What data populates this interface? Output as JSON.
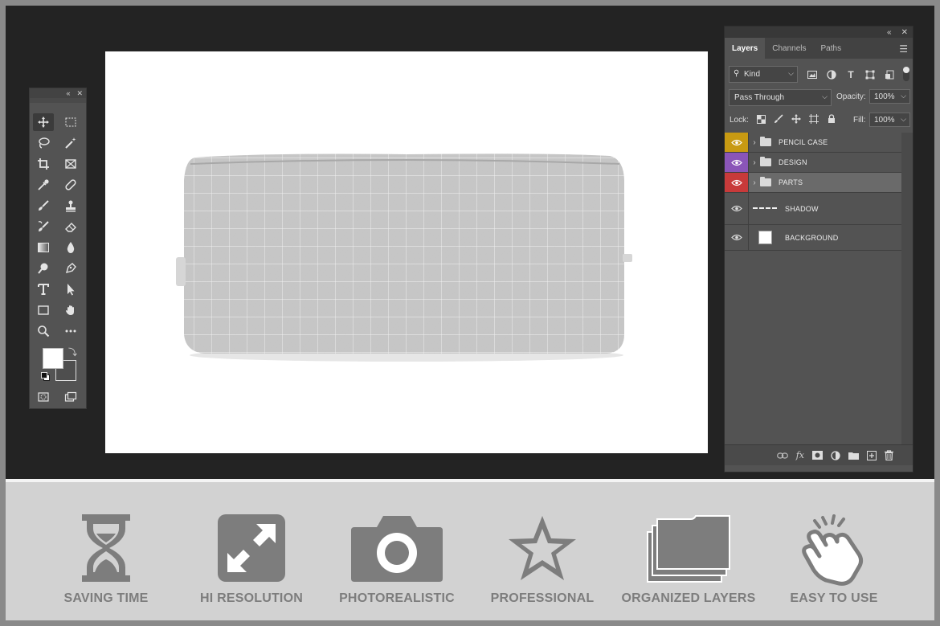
{
  "panel": {
    "tabs": [
      "Layers",
      "Channels",
      "Paths"
    ],
    "filter_kind": "Kind",
    "blend_mode": "Pass Through",
    "opacity_label": "Opacity:",
    "opacity_value": "100%",
    "lock_label": "Lock:",
    "fill_label": "Fill:",
    "fill_value": "100%",
    "layers": [
      {
        "name": "PENCIL CASE",
        "type": "group",
        "color": "#c89a12"
      },
      {
        "name": "DESIGN",
        "type": "group",
        "color": "#8a55b8"
      },
      {
        "name": "PARTS",
        "type": "group",
        "color": "#c83a3a"
      },
      {
        "name": "SHADOW",
        "type": "layer",
        "color": ""
      },
      {
        "name": "BACKGROUND",
        "type": "layer",
        "color": ""
      }
    ]
  },
  "features": [
    {
      "label": "SAVING TIME",
      "icon": "hourglass-icon"
    },
    {
      "label": "HI RESOLUTION",
      "icon": "expand-icon"
    },
    {
      "label": "PHOTOREALISTIC",
      "icon": "camera-icon"
    },
    {
      "label": "PROFESSIONAL",
      "icon": "star-icon"
    },
    {
      "label": "ORGANIZED LAYERS",
      "icon": "folders-icon"
    },
    {
      "label": "EASY TO USE",
      "icon": "hand-pointer-icon"
    }
  ],
  "colors": {
    "workspace": "#232323",
    "panel": "#535353",
    "feature_icon": "#7d7d7d"
  }
}
